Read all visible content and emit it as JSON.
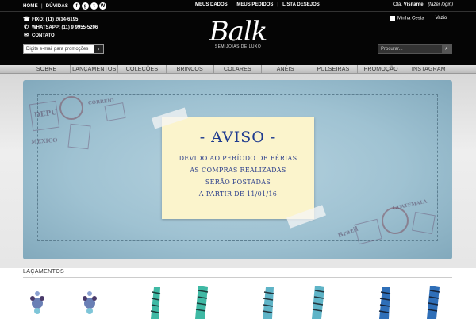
{
  "topbar": {
    "home": "HOME",
    "faq": "DÚVIDAS",
    "social_icons": [
      "facebook-icon",
      "google-plus-icon",
      "twitter-icon",
      "wordpress-icon"
    ],
    "account_links": [
      "MEUS DADOS",
      "MEUS PEDIDOS",
      "LISTA DESEJOS"
    ],
    "greeting": "Olá,",
    "visitor": "Visitante",
    "login": "(fazer login)"
  },
  "contacts": {
    "phone": "FIXO: (11) 2614-6195",
    "whatsapp": "WHATSAPP: (11) 9 9955-5206",
    "contact": "CONTATO"
  },
  "logo": {
    "name": "Balk",
    "tagline": "SEMIJÓIAS DE LUXO"
  },
  "cart": {
    "label": "Minha Cesta",
    "status": "Vazio"
  },
  "promo": {
    "placeholder": "Digite e-mail para promoções",
    "button": "›"
  },
  "search": {
    "placeholder": "Procurar...",
    "button": "⌕"
  },
  "nav": [
    "SOBRE",
    "LANÇAMENTOS",
    "COLEÇÕES",
    "BRINCOS",
    "COLARES",
    "ANÉIS",
    "PULSEIRAS",
    "PROMOÇÃO",
    "INSTAGRAM"
  ],
  "banner": {
    "title": "- AVISO -",
    "lines": [
      "DEVIDO AO PERÍODO DE FÉRIAS",
      "AS COMPRAS REALIZADAS",
      "SERÃO POSTADAS",
      "A PARTIR DE 11/01/16"
    ],
    "stamps": [
      "DEPU",
      "CORREIO",
      "MEXICO",
      "Brazil",
      "GUATEMALA"
    ]
  },
  "section": {
    "title": "LAÇAMENTOS"
  },
  "colors": {
    "topbar": "#050505",
    "note_text": "#1e3a8f",
    "banner": "#9fc2d2"
  }
}
